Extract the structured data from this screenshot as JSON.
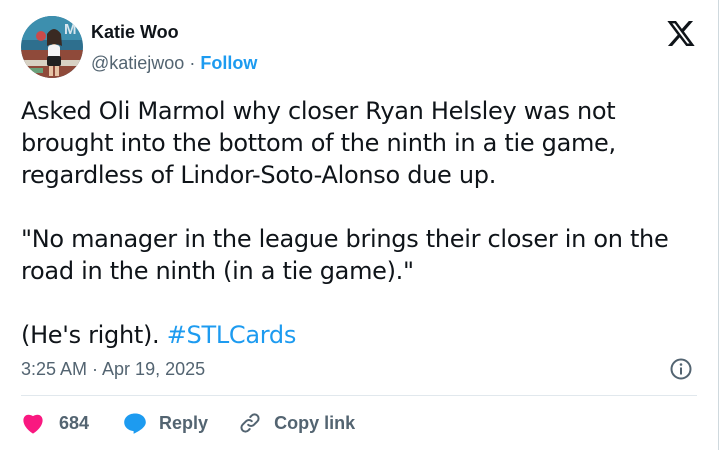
{
  "author": {
    "name": "Katie Woo",
    "handle": "@katiejwoo",
    "separator": "·",
    "follow_label": "Follow"
  },
  "tweet": {
    "paragraphs": [
      "Asked Oli Marmol why closer Ryan Helsley was not brought into the bottom of the ninth in a tie game, regardless of Lindor-Soto-Alonso due up.",
      "\"No manager in the league brings their closer in on the road in the ninth (in a tie game).\""
    ],
    "last_paragraph_text": "(He's right).",
    "hashtag": "#STLCards",
    "timestamp": "3:25 AM · Apr 19, 2025"
  },
  "actions": {
    "like_count": "684",
    "reply_label": "Reply",
    "copy_link_label": "Copy link"
  },
  "colors": {
    "link_blue": "#1d9bf0",
    "like_red": "#f91880",
    "muted_gray": "#536471",
    "text_black": "#0f1419"
  },
  "icons": {
    "platform_logo": "x-logo-icon",
    "info": "info-icon",
    "like": "heart-icon",
    "reply": "speech-bubble-icon",
    "copy_link": "link-icon"
  }
}
